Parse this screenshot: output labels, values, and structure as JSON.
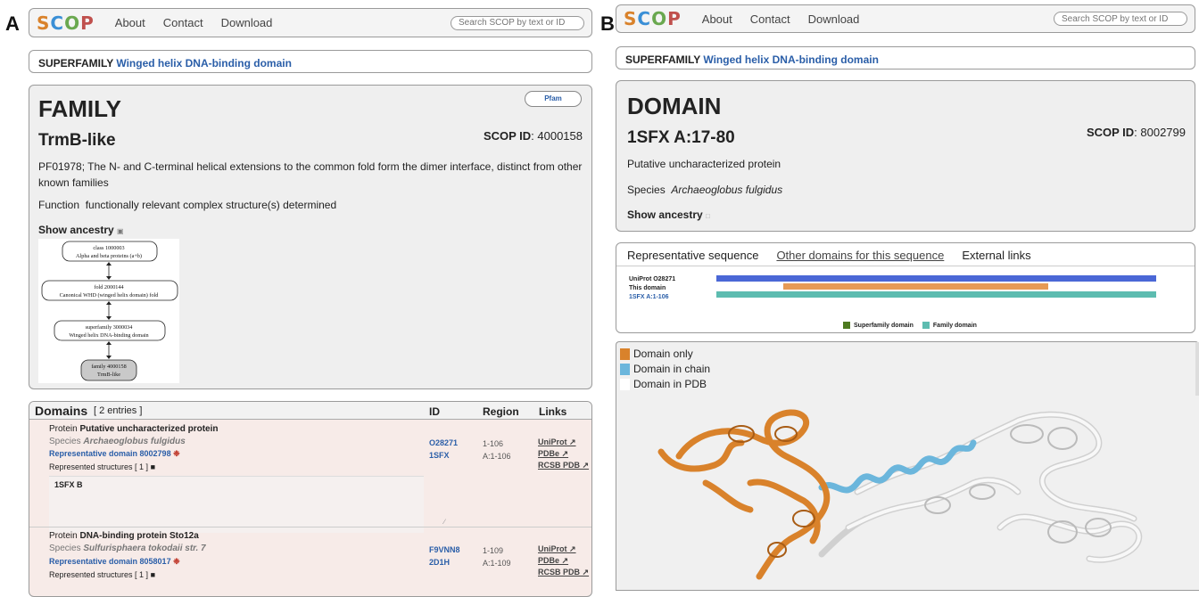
{
  "panelA": {
    "letter": "A",
    "nav": {
      "logo": "SCOP",
      "about": "About",
      "contact": "Contact",
      "download": "Download",
      "search_placeholder": "Search SCOP by text or ID"
    },
    "superfamily": {
      "label": "SUPERFAMILY",
      "name": "Winged helix DNA-binding domain"
    },
    "family": {
      "heading": "FAMILY",
      "name": "TrmB-like",
      "scop_id_label": "SCOP ID",
      "scop_id": ": 4000158",
      "pfam_button": "Pfam",
      "description": "PF01978; The N- and C-terminal helical extensions to the common fold form the dimer interface, distinct from other known families",
      "function_label": "Function",
      "function_text": "functionally relevant complex structure(s) determined",
      "show_ancestry": "Show ancestry"
    },
    "ancestry": [
      {
        "line1": "class 1000003",
        "line2": "Alpha and beta proteins (a+b)"
      },
      {
        "line1": "fold 2000144",
        "line2": "Canonical WHD (winged helix domain) fold"
      },
      {
        "line1": "superfamily 3000034",
        "line2": "Winged helix DNA-binding domain"
      },
      {
        "line1": "family 4000158",
        "line2": "TrmB-like"
      }
    ],
    "domains": {
      "title": "Domains",
      "count": "[ 2 entries ]",
      "col_id": "ID",
      "col_region": "Region",
      "col_links": "Links",
      "entries": [
        {
          "protein_label": "Protein",
          "protein": "Putative uncharacterized protein",
          "species_label": "Species",
          "species": "Archaeoglobus fulgidus",
          "rep_domain": "Representative domain 8002798",
          "structures": "Represented structures [ 1 ]",
          "structure_item": "1SFX B",
          "id1": "O28271",
          "id2": "1SFX",
          "region1": "1-106",
          "region2": "A:1-106",
          "link1": "UniProt",
          "link2": "PDBe",
          "link3": "RCSB PDB"
        },
        {
          "protein_label": "Protein",
          "protein": "DNA-binding protein Sto12a",
          "species_label": "Species",
          "species": "Sulfurisphaera tokodaii str. 7",
          "rep_domain": "Representative domain 8058017",
          "structures": "Represented structures [ 1 ]",
          "id1": "F9VNN8",
          "id2": "2D1H",
          "region1": "1-109",
          "region2": "A:1-109",
          "link1": "UniProt",
          "link2": "PDBe",
          "link3": "RCSB PDB"
        }
      ]
    }
  },
  "panelB": {
    "letter": "B",
    "nav": {
      "logo": "SCOP",
      "about": "About",
      "contact": "Contact",
      "download": "Download",
      "search_placeholder": "Search SCOP by text or ID"
    },
    "superfamily": {
      "label": "SUPERFAMILY",
      "name": "Winged helix DNA-binding domain"
    },
    "domain": {
      "heading": "DOMAIN",
      "name": "1SFX A:17-80",
      "scop_id_label": "SCOP ID",
      "scop_id": ": 8002799",
      "description": "Putative uncharacterized protein",
      "species_label": "Species",
      "species": "Archaeoglobus fulgidus",
      "show_ancestry": "Show ancestry"
    },
    "tabs": {
      "representative": "Representative sequence",
      "other": "Other domains for this sequence",
      "external": "External links"
    },
    "seq_labels": {
      "uniprot": "UniProt O28271",
      "this_domain": "This domain",
      "chain": "1SFX A:1-106"
    },
    "seq_legend": {
      "superfamily": "Superfamily domain",
      "family": "Family domain"
    },
    "viewer_legend": {
      "domain_only": "Domain only",
      "domain_chain": "Domain in chain",
      "domain_pdb": "Domain in PDB"
    },
    "colors": {
      "uniprot_bar": "#4a67d6",
      "domain_bar": "#e69a55",
      "family_bar": "#5dbcb0",
      "superfamily": "#4d7a1f",
      "orange": "#d9822b",
      "blue": "#6bb6dc"
    }
  }
}
